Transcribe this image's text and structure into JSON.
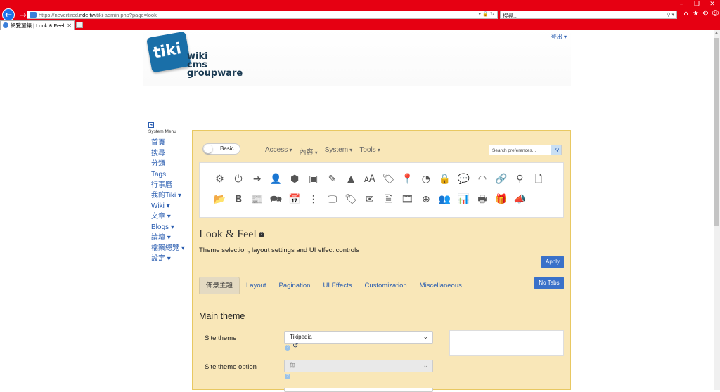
{
  "browser": {
    "url_prefix": "https://nevertired.",
    "url_domain": "nde.tw",
    "url_path": "/tiki-admin.php?page=look",
    "search_placeholder": "搜尋...",
    "tab_title": "網覽選錶 | Look & Feel"
  },
  "header": {
    "logo_word": "tiki",
    "logo_lines": [
      "wiki",
      "cms",
      "groupware"
    ],
    "logout": "登出 ▾"
  },
  "menu": {
    "heading": "System Menu",
    "items": [
      "首頁",
      "搜尋",
      "分類",
      "Tags",
      "行事曆",
      "我的Tiki ▾",
      "Wiki ▾",
      "文章 ▾",
      "Blogs ▾",
      "論壇 ▾",
      "檔案總覽 ▾",
      "設定 ▾"
    ]
  },
  "admin": {
    "toggle_label": "Basic",
    "nav": [
      "Access",
      "內容",
      "System",
      "Tools"
    ],
    "search_placeholder": "Search preferences...",
    "title": "Look & Feel",
    "subtitle": "Theme selection, layout settings and UI effect controls",
    "apply": "Apply",
    "tabs": [
      "佈景主題",
      "Layout",
      "Pagination",
      "UI Effects",
      "Customization",
      "Miscellaneous"
    ],
    "no_tabs": "No Tabs",
    "section_title": "Main theme",
    "site_theme_label": "Site theme",
    "site_theme_value": "Tikipedia",
    "site_theme_option_label": "Site theme option",
    "site_theme_option_value": "無"
  },
  "icons_row1": [
    "gear-icon",
    "power-icon",
    "sign-in-icon",
    "user-icon",
    "cube-icon",
    "image-icon",
    "edit-icon",
    "shapes-icon",
    "language-icon",
    "tag-icon",
    "map-marker-icon",
    "dashboard-icon",
    "lock-icon",
    "comment-icon",
    "rss-icon",
    "link-icon",
    "search-icon",
    "file-icon"
  ],
  "icons_row2": [
    "folder-open-icon",
    "bold-icon",
    "newspaper-icon",
    "comments-icon",
    "calendar-icon",
    "structure-icon",
    "desktop-icon",
    "tags-icon",
    "envelope-icon",
    "file-text-icon",
    "film-icon",
    "zoom-in-icon",
    "users-icon",
    "bar-chart-icon",
    "print-icon",
    "gift-icon",
    "bullhorn-icon"
  ],
  "colors": {
    "chrome": "#e60012",
    "panel": "#f9e7b8",
    "link": "#2a5db0",
    "button": "#3a71c9"
  }
}
